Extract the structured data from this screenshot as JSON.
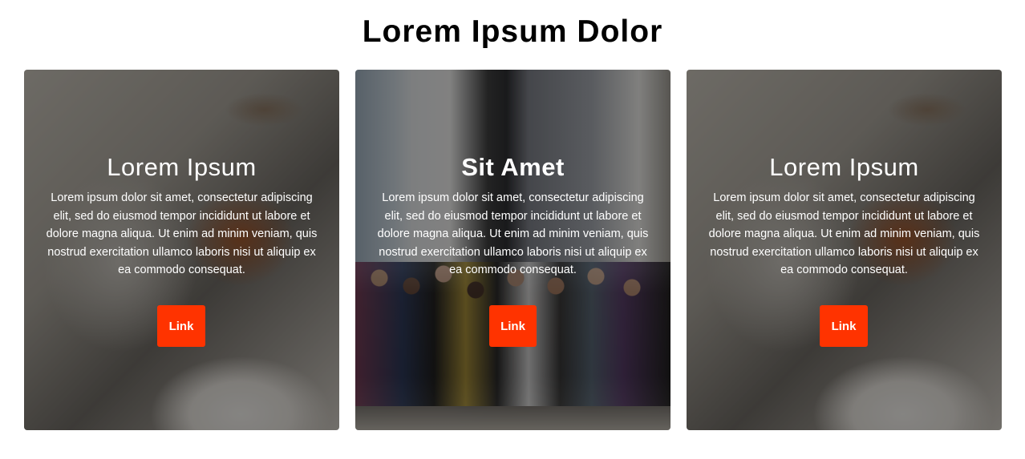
{
  "page": {
    "title": "Lorem Ipsum Dolor"
  },
  "cards": [
    {
      "title": "Lorem Ipsum",
      "text": "Lorem ipsum dolor sit amet, consectetur adipiscing elit, sed do eiusmod tempor incididunt ut labore et dolore magna aliqua. Ut enim ad minim veniam, quis nostrud exercitation ullamco laboris nisi ut aliquip ex ea commodo consequat.",
      "button_label": "Link"
    },
    {
      "title": "Sit Amet",
      "text": "Lorem ipsum dolor sit amet, consectetur adipiscing elit, sed do eiusmod tempor incididunt ut labore et dolore magna aliqua. Ut enim ad minim veniam, quis nostrud exercitation ullamco laboris nisi ut aliquip ex ea commodo consequat.",
      "button_label": "Link"
    },
    {
      "title": "Lorem Ipsum",
      "text": "Lorem ipsum dolor sit amet, consectetur adipiscing elit, sed do eiusmod tempor incididunt ut labore et dolore magna aliqua. Ut enim ad minim veniam, quis nostrud exercitation ullamco laboris nisi ut aliquip ex ea commodo consequat.",
      "button_label": "Link"
    }
  ],
  "colors": {
    "button": "#ff3300",
    "overlay": "#000000"
  }
}
